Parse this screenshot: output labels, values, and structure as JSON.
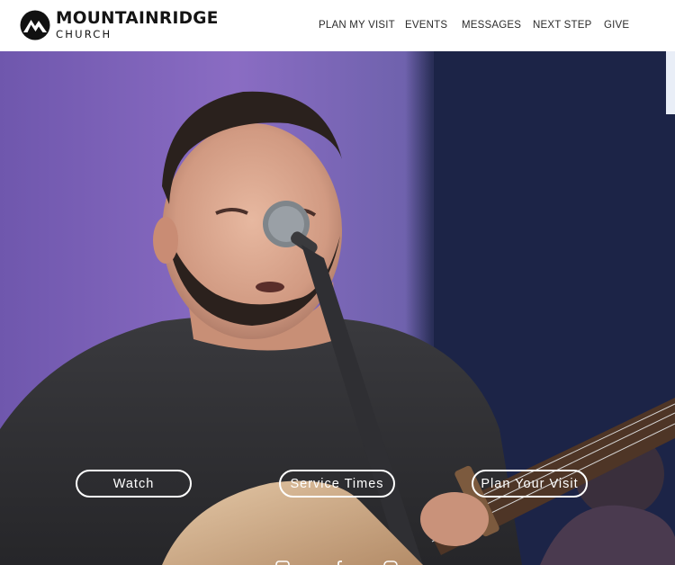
{
  "brand": {
    "name": "MOUNTAINRIDGE",
    "subtitle": "CHURCH",
    "logo_icon": "mountain-logo-icon"
  },
  "nav": {
    "items": [
      {
        "label": "PLAN MY VISIT"
      },
      {
        "label": "EVENTS"
      },
      {
        "label": "MESSAGES"
      },
      {
        "label": "NEXT STEP"
      },
      {
        "label": "GIVE"
      }
    ]
  },
  "hero": {
    "image": "worship-leader-singing-with-guitar",
    "buttons": {
      "watch": "Watch",
      "service_times": "Service Times",
      "plan_visit": "Plan Your Visit"
    }
  },
  "social": {
    "icons": [
      "youtube-icon",
      "facebook-icon",
      "instagram-icon"
    ]
  },
  "colors": {
    "header_bg": "#ffffff",
    "text_dark": "#141414",
    "button_border": "#ffffff",
    "stage_purple": "#8b6bc2",
    "stage_dark": "#1a2142"
  }
}
